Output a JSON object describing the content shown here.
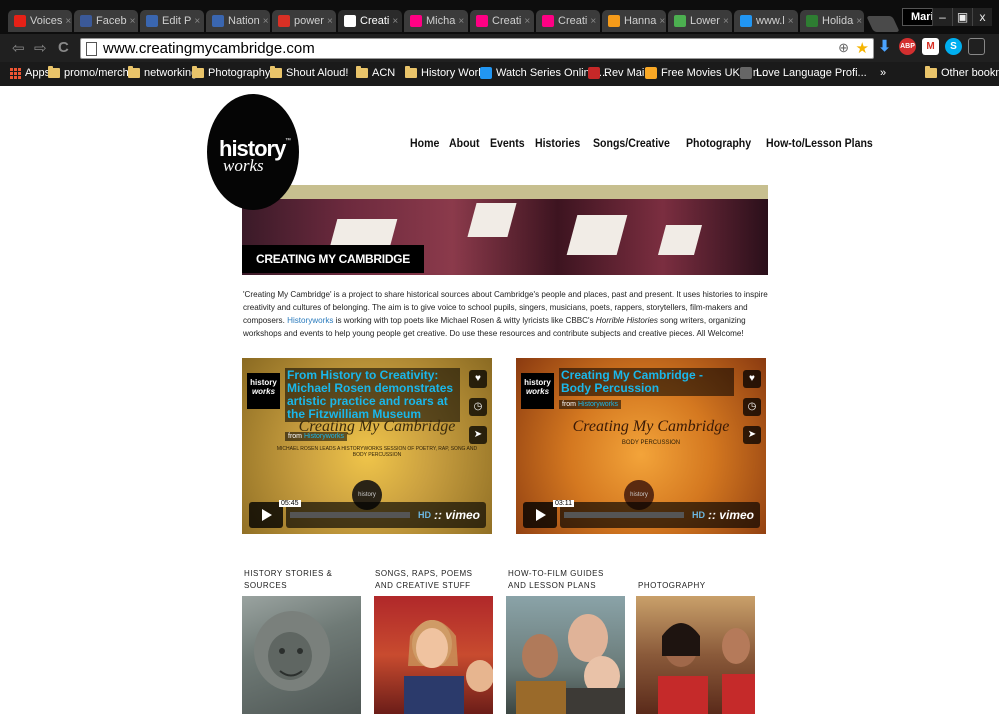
{
  "browser": {
    "tabs": [
      {
        "label": "Voices",
        "icon": "youtube-icon",
        "color": "#e62117"
      },
      {
        "label": "Faceb",
        "icon": "facebook-icon",
        "color": "#3b5998"
      },
      {
        "label": "Edit P",
        "icon": "bbc-icon",
        "color": "#3a66b0"
      },
      {
        "label": "Nation",
        "icon": "bbc-icon",
        "color": "#3a66b0"
      },
      {
        "label": "power",
        "icon": "gmail-icon",
        "color": "#d93025"
      },
      {
        "label": "Creati",
        "icon": "page-icon",
        "color": "#ffffff"
      },
      {
        "label": "Micha",
        "icon": "flickr-icon",
        "color": "#ff0084"
      },
      {
        "label": "Creati",
        "icon": "flickr-icon",
        "color": "#ff0084"
      },
      {
        "label": "Creati",
        "icon": "flickr-icon",
        "color": "#ff0084"
      },
      {
        "label": "Hanna",
        "icon": "dots-icon",
        "color": "#f59b1a"
      },
      {
        "label": "Lower",
        "icon": "pinwheel-icon",
        "color": "#4caf50"
      },
      {
        "label": "www.l",
        "icon": "site-icon",
        "color": "#2196f3"
      },
      {
        "label": "Holida",
        "icon": "calendar-icon",
        "color": "#2e7d32"
      }
    ],
    "user": "Mario",
    "window": {
      "minimize": "–",
      "restore": "▣",
      "close": "x"
    },
    "url": "www.creatingmycambridge.com",
    "bookmarks": [
      {
        "label": "Apps",
        "type": "apps"
      },
      {
        "label": "promo/merch",
        "type": "folder"
      },
      {
        "label": "networking",
        "type": "folder"
      },
      {
        "label": "Photography",
        "type": "folder"
      },
      {
        "label": "Shout Aloud!",
        "type": "folder"
      },
      {
        "label": "ACN",
        "type": "folder"
      },
      {
        "label": "History Works",
        "type": "folder"
      },
      {
        "label": "Watch Series Online ...",
        "type": "link"
      },
      {
        "label": "Rev Mail",
        "type": "link"
      },
      {
        "label": "Free Movies UK • In...",
        "type": "link"
      },
      {
        "label": "Love Language Profi...",
        "type": "link"
      },
      {
        "label": "»",
        "type": "more"
      },
      {
        "label": "Other bookmarks",
        "type": "folder"
      }
    ]
  },
  "site": {
    "logo": {
      "line1": "history",
      "line2": "works",
      "tm": "™"
    },
    "nav": [
      "Home",
      "About",
      "Events",
      "Histories",
      "Songs/Creative",
      "Photography",
      "How-to/Lesson Plans"
    ],
    "banner_label": "CREATING MY CAMBRIDGE",
    "intro": {
      "part1": "'Creating My Cambridge' is a project to share historical sources about Cambridge's people and places, past and present. It uses histories to inspire creativity and cultures of belonging. The aim is to give voice to school pupils, singers, musicians, poets, rappers, storytellers, film-makers and composers. ",
      "link": "Historyworks",
      "part2": " is working with top poets like Michael Rosen & witty lyricists like CBBC's ",
      "italic": "Horrible Histories",
      "part3": " song writers, organizing workshops and events to help young people get creative. Do use these resources and contribute subjects and creative pieces.  All Welcome!"
    },
    "videos": [
      {
        "title": "From History to Creativity: Michael Rosen demonstrates artistic practice and roars at the Fitzwilliam Museum",
        "from": "from",
        "channel": "Historyworks",
        "script": "Creating My Cambridge",
        "subtitle": "MICHAEL ROSEN LEADS A HISTORYWORKS SESSION OF POETRY, RAP, SONG AND BODY PERCUSSION",
        "time": "05:45",
        "hd": "HD",
        "brand": ":: vimeo"
      },
      {
        "title": "Creating My Cambridge - Body Percussion",
        "from": "from",
        "channel": "Historyworks",
        "script": "Creating My Cambridge",
        "subtitle": "BODY PERCUSSION",
        "time": "03:11",
        "hd": "HD",
        "brand": ":: vimeo"
      }
    ],
    "video_logo": {
      "line1": "history",
      "line2": "works"
    },
    "video_badge": "history",
    "categories": [
      {
        "label": "HISTORY STORIES & SOURCES"
      },
      {
        "label": "SONGS, RAPS, POEMS AND CREATIVE STUFF"
      },
      {
        "label": "HOW-TO-FILM GUIDES AND LESSON PLANS"
      },
      {
        "label": "PHOTOGRAPHY"
      }
    ]
  }
}
